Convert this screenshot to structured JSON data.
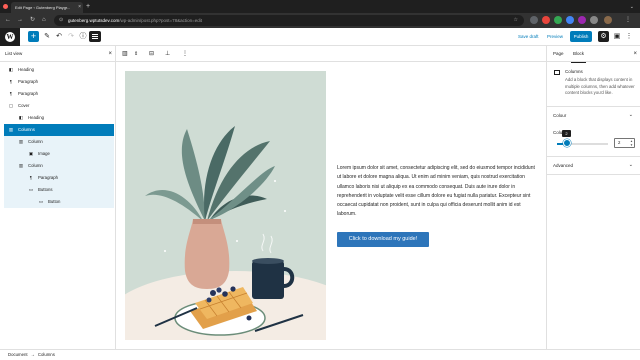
{
  "browser": {
    "tab_title": "Edit Page ‹ Gutenberg Playgr...",
    "tab_close": "×",
    "new_tab": "+",
    "tab_menu": "⌄",
    "url_host": "gutenberg.wptutsdev.com",
    "url_path": "/wp-admin/post.php?post=78&action=edit",
    "window_colors": [
      "#ff5f57",
      "#febc2e",
      "#28c840"
    ]
  },
  "editor_header": {
    "save_draft": "Save draft",
    "preview": "Preview",
    "publish": "Publish",
    "accent": "#007cba"
  },
  "list_view": {
    "title": "List view",
    "close": "×",
    "items": [
      {
        "label": "Heading",
        "icon": "heading-icon",
        "glyph": "◧"
      },
      {
        "label": "Paragraph",
        "icon": "paragraph-icon",
        "glyph": "¶"
      },
      {
        "label": "Paragraph",
        "icon": "paragraph-icon",
        "glyph": "¶"
      },
      {
        "label": "Cover",
        "icon": "cover-icon",
        "glyph": "▢"
      },
      {
        "label": "Heading",
        "icon": "heading-icon",
        "glyph": "◧"
      },
      {
        "label": "Columns",
        "icon": "columns-icon",
        "glyph": "▥"
      },
      {
        "label": "Column",
        "icon": "column-icon",
        "glyph": "▥"
      },
      {
        "label": "Image",
        "icon": "image-icon",
        "glyph": "▣"
      },
      {
        "label": "Column",
        "icon": "column-icon",
        "glyph": "▥"
      },
      {
        "label": "Paragraph",
        "icon": "paragraph-icon",
        "glyph": "¶"
      },
      {
        "label": "Buttons",
        "icon": "buttons-icon",
        "glyph": "▭"
      },
      {
        "label": "Button",
        "icon": "button-icon",
        "glyph": "▭"
      }
    ]
  },
  "content": {
    "paragraph": "Lorem ipsum dolor sit amet, consectetur adipiscing elit, sed do eiusmod tempor incididunt ut labore et dolore magna aliqua. Ut enim ad minim veniam, quis nostrud exercitation ullamco laboris nisi ut aliquip ex ea commodo consequat. Duis aute irure dolor in reprehenderit in voluptate velit esse cillum dolore eu fugiat nulla pariatur. Excepteur sint occaecat cupidatat non proident, sunt in culpa qui officia deserunt mollit anim id est laborum.",
    "button_label": "Click to download my guide!"
  },
  "settings_sidebar": {
    "tab_page": "Page",
    "tab_block": "Block",
    "close": "×",
    "block_title": "Columns",
    "block_description": "Add a block that displays content in multiple columns, then add whatever content blocks you'd like.",
    "colour_panel": "Colour",
    "columns_label": "Colu",
    "columns_value": "2",
    "columns_tooltip": "2",
    "advanced_panel": "Advanced"
  },
  "footer": {
    "breadcrumb": [
      "Document",
      "Columns"
    ],
    "separator": "→"
  }
}
